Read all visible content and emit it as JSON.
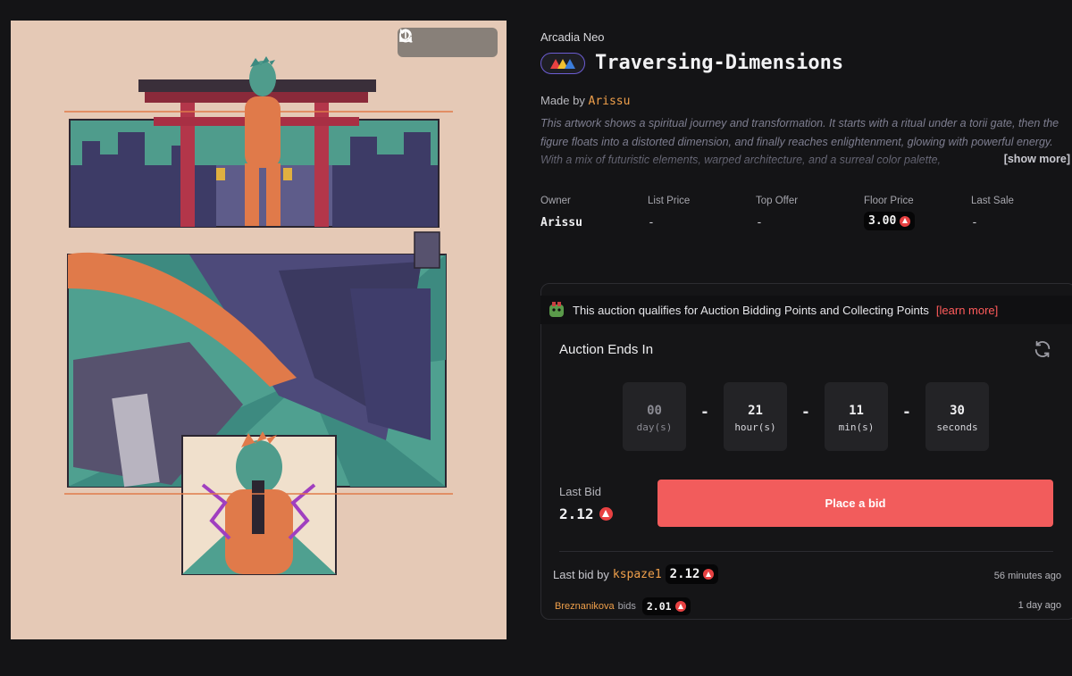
{
  "artwork": {
    "toolbar": {
      "refresh_icon": "refresh-icon",
      "zoom_icon": "search-icon",
      "share_icon": "share-icon"
    }
  },
  "collection": "Arcadia Neo",
  "title": "Traversing-Dimensions",
  "made_by": {
    "prefix": "Made by",
    "artist": "Arissu"
  },
  "description": "This artwork shows a spiritual journey and transformation. It starts with a ritual under a torii gate, then the figure floats into a distorted dimension, and finally reaches enlightenment, glowing with powerful energy. With a mix of futuristic elements, warped architecture, and a surreal color palette,",
  "show_more": "[show more]",
  "stats": {
    "owner": {
      "label": "Owner",
      "value": "Arissu"
    },
    "list_price": {
      "label": "List Price",
      "value": "-"
    },
    "top_offer": {
      "label": "Top Offer",
      "value": "-"
    },
    "floor_price": {
      "label": "Floor Price",
      "value": "3.00"
    },
    "last_sale": {
      "label": "Last Sale",
      "value": "-"
    }
  },
  "auction": {
    "qualify_text": "This auction qualifies for Auction Bidding Points and Collecting Points",
    "learn_more": "[learn more]",
    "ends_label": "Auction Ends In",
    "timer": [
      {
        "value": "00",
        "unit": "day(s)"
      },
      {
        "value": "21",
        "unit": "hour(s)"
      },
      {
        "value": "11",
        "unit": "min(s)"
      },
      {
        "value": "30",
        "unit": "seconds"
      }
    ],
    "separator": "-",
    "last_bid_label": "Last Bid",
    "last_bid_value": "2.12",
    "place_bid_label": "Place a bid",
    "history": [
      {
        "prefix": "Last bid by",
        "bidder": "kspaze1",
        "amount": "2.12",
        "time": "56 minutes ago"
      },
      {
        "bidder": "Breznanikova",
        "verb": "bids",
        "amount": "2.01",
        "time": "1 day ago"
      }
    ]
  },
  "colors": {
    "accent": "#f25c5c",
    "artist": "#f0a04b",
    "avax": "#e84142",
    "background": "#141416"
  }
}
